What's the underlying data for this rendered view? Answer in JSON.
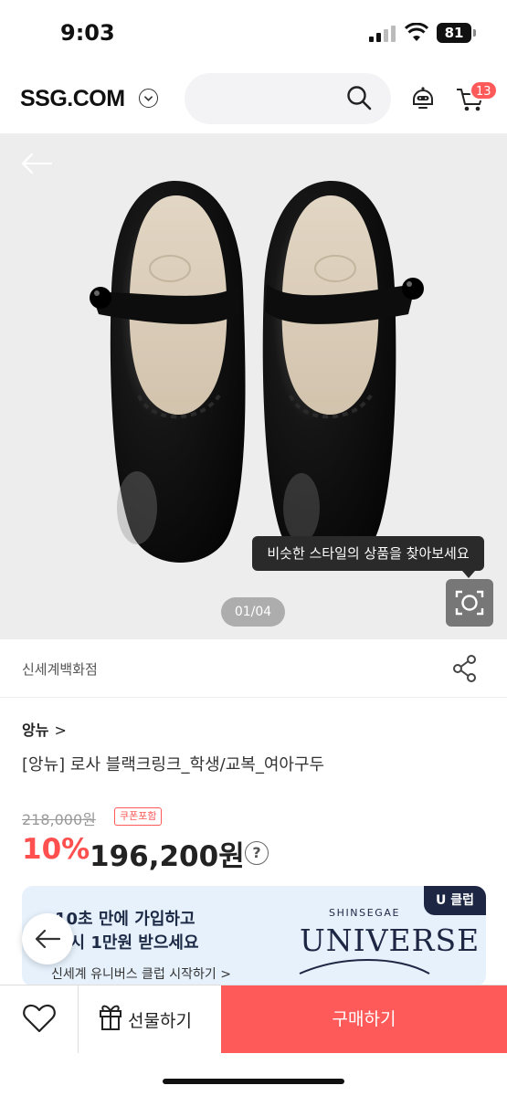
{
  "status_bar": {
    "time": "9:03",
    "battery": "81"
  },
  "header": {
    "logo": "SSG.COM",
    "cart_count": "13"
  },
  "hero": {
    "tooltip": "비슷한 스타일의 상품을 찾아보세요",
    "page_indicator": "01/04"
  },
  "store": {
    "name": "신세계백화점"
  },
  "product": {
    "brand": "앙뉴",
    "brand_chevron": ">",
    "title": "[앙뉴] 로사 블랙크링크_학생/교복_여아구두",
    "original_price": "218,000원",
    "coupon_badge": "쿠폰포함",
    "discount_rate": "10%",
    "sale_price": "196,200원",
    "info_icon": "?"
  },
  "promo": {
    "line1": "10초 만에 가입하고",
    "line2": "즉시 1만원 받으세요",
    "cta": "신세계 유니버스 클럽 시작하기 >",
    "badge": "U 클럽",
    "brand_small": "SHINSEGAE",
    "brand_large": "UNIVERSE"
  },
  "bottom_bar": {
    "gift_label": "선물하기",
    "buy_label": "구매하기"
  },
  "colors": {
    "accent": "#ff5a5a",
    "discount": "#ff4f4f",
    "banner_bg": "#e6f1fc",
    "navy": "#1d2744"
  },
  "icons": [
    "search-icon",
    "bot-icon",
    "cart-icon",
    "back-arrow-icon",
    "lens-icon",
    "share-icon",
    "heart-icon",
    "gift-icon"
  ]
}
